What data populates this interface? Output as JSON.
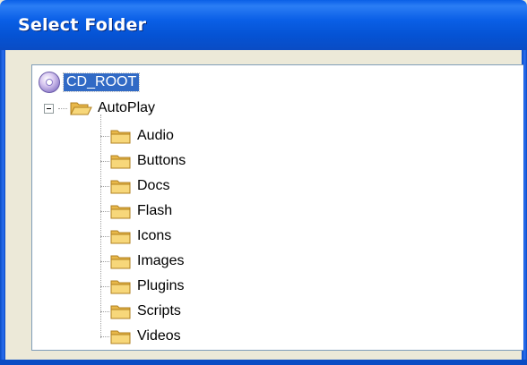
{
  "window": {
    "title": "Select Folder"
  },
  "tree": {
    "root": {
      "label": "CD_ROOT",
      "icon": "cd-disc-icon",
      "selected": true
    },
    "autoplay": {
      "label": "AutoPlay",
      "icon": "folder-open-icon",
      "expanded": true
    },
    "children": [
      {
        "label": "Audio"
      },
      {
        "label": "Buttons"
      },
      {
        "label": "Docs"
      },
      {
        "label": "Flash"
      },
      {
        "label": "Icons"
      },
      {
        "label": "Images"
      },
      {
        "label": "Plugins"
      },
      {
        "label": "Scripts"
      },
      {
        "label": "Videos"
      }
    ]
  },
  "colors": {
    "title_bar": "#0a5fe6",
    "selection": "#316ac5",
    "folder": "#f7d77a"
  }
}
